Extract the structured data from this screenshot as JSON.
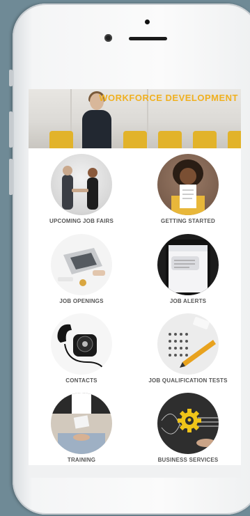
{
  "banner": {
    "title": "WORKFORCE DEVELOPMENT"
  },
  "tiles": [
    {
      "label": "UPCOMING JOB FAIRS"
    },
    {
      "label": "GETTING STARTED"
    },
    {
      "label": "JOB OPENINGS"
    },
    {
      "label": "JOB ALERTS"
    },
    {
      "label": "CONTACTS"
    },
    {
      "label": "JOB QUALIFICATION TESTS"
    },
    {
      "label": "TRAINING"
    },
    {
      "label": "BUSINESS SERVICES"
    }
  ],
  "colors": {
    "accent": "#f0b020",
    "background": "#6f8a96",
    "label": "#555555"
  }
}
